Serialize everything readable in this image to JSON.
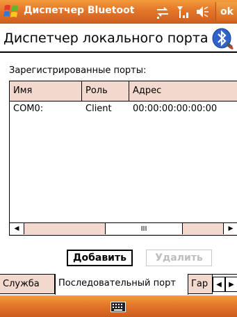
{
  "titlebar": {
    "title": "Диспетчер Bluetoot",
    "ok_label": "ok",
    "icons": [
      "windows-start-icon",
      "sync-icon",
      "signal-icon",
      "volume-icon"
    ]
  },
  "header": {
    "title": "Диспетчер локального порта",
    "icon": "bluetooth-icon"
  },
  "content": {
    "registered_label": "Зарегистрированные порты:",
    "columns": [
      "Имя",
      "Роль",
      "Адрес"
    ],
    "rows": [
      {
        "name": "COM0:",
        "role": "Client",
        "address": "00:00:00:00:00:00"
      }
    ],
    "scroll_grip": "III"
  },
  "buttons": {
    "add": "Добавить",
    "delete": "Удалить"
  },
  "tabs": [
    {
      "label": "Служба",
      "active": false
    },
    {
      "label": "Последовательный порт",
      "active": true
    },
    {
      "label": "Гар",
      "active": false
    }
  ],
  "colors": {
    "accent_orange": "#e4762a",
    "header_fill": "#f3d8cd"
  },
  "menubar": {
    "icon": "keyboard-icon"
  }
}
